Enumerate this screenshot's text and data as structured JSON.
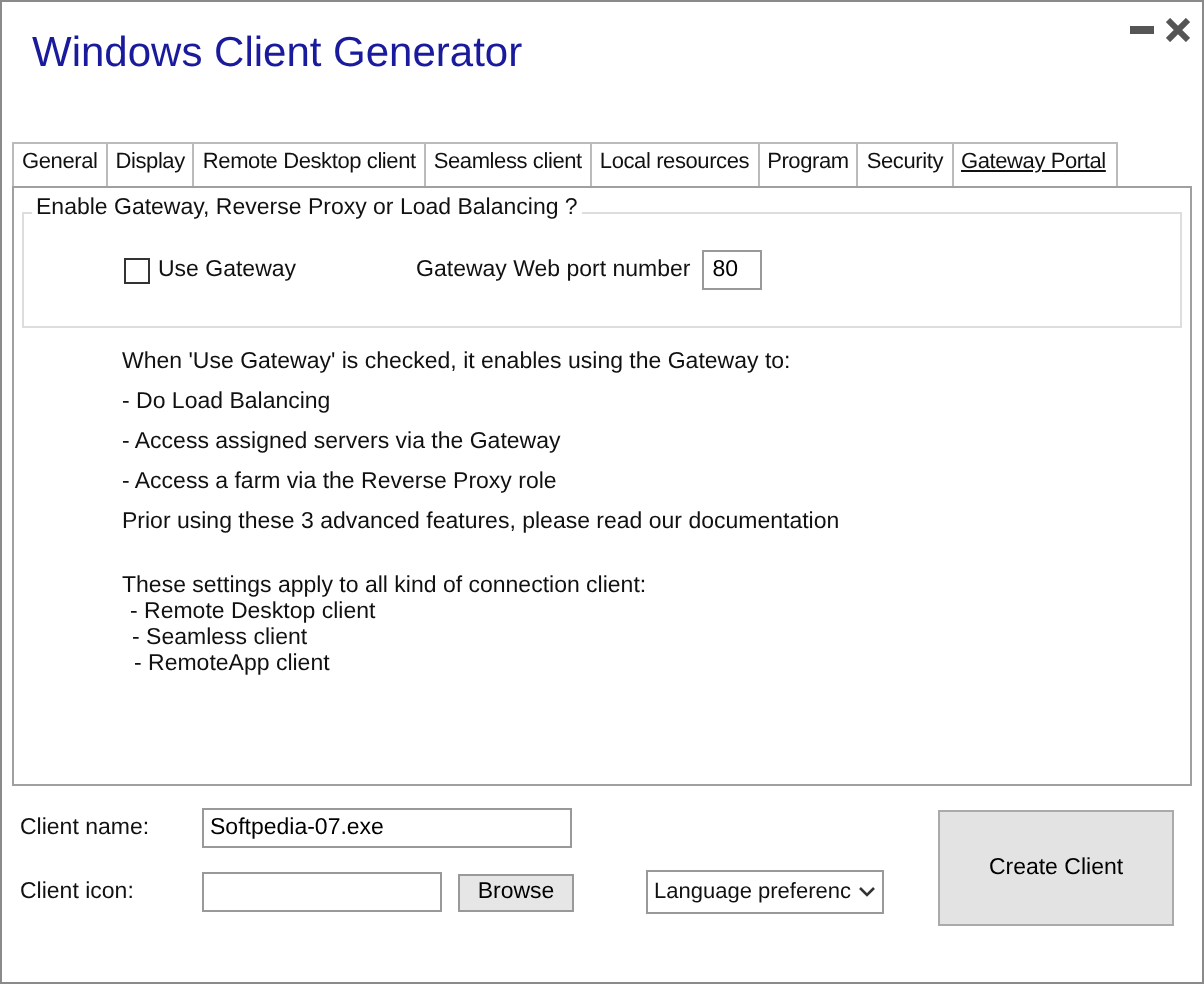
{
  "window": {
    "title": "Windows Client Generator"
  },
  "tabs": [
    {
      "label": "General",
      "selected": false
    },
    {
      "label": "Display",
      "selected": false
    },
    {
      "label": "Remote Desktop client",
      "selected": false
    },
    {
      "label": "Seamless client",
      "selected": false
    },
    {
      "label": "Local resources",
      "selected": false
    },
    {
      "label": "Program",
      "selected": false
    },
    {
      "label": "Security",
      "selected": false
    },
    {
      "label": "Gateway Portal",
      "selected": true
    }
  ],
  "gateway_group": {
    "title": "Enable Gateway, Reverse Proxy or Load Balancing ?",
    "use_gateway": {
      "label": "Use Gateway",
      "checked": false
    },
    "port_label": "Gateway Web port number",
    "port_value": "80"
  },
  "info_lines": [
    "When 'Use Gateway' is checked, it enables using the Gateway to:",
    "- Do Load Balancing",
    "- Access assigned servers via the Gateway",
    "- Access a farm via the Reverse Proxy role",
    "Prior using these 3 advanced features, please read our documentation"
  ],
  "applies": {
    "heading": "These settings apply to all kind of connection client:",
    "items": [
      "- Remote Desktop client",
      "- Seamless client",
      "- RemoteApp client"
    ]
  },
  "client_name": {
    "label": "Client name:",
    "value": "Softpedia-07.exe"
  },
  "client_icon": {
    "label": "Client icon:"
  },
  "browse_button": "Browse",
  "language_dropdown": "Language preferenc",
  "create_button": "Create Client"
}
